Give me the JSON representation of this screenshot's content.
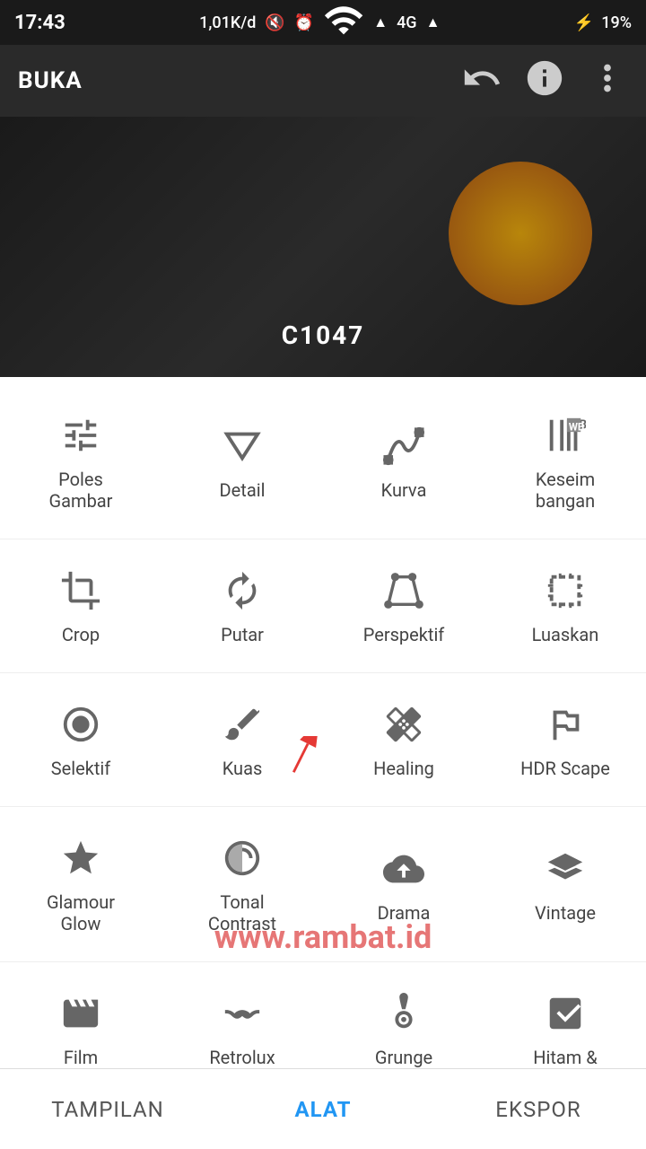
{
  "statusBar": {
    "time": "17:43",
    "network": "1,01K/d",
    "carrier": "4G",
    "battery": "19%"
  },
  "topBar": {
    "title": "BUKA"
  },
  "preview": {
    "label": "C1047"
  },
  "toolsGrid": {
    "rows": [
      [
        {
          "id": "poles-gambar",
          "label": "Poles\nGambar",
          "icon": "sliders"
        },
        {
          "id": "detail",
          "label": "Detail",
          "icon": "triangle-down"
        },
        {
          "id": "kurva",
          "label": "Kurva",
          "icon": "curve"
        },
        {
          "id": "keseimbangan",
          "label": "Keseim\nbangan",
          "icon": "wb"
        }
      ],
      [
        {
          "id": "crop",
          "label": "Crop",
          "icon": "crop"
        },
        {
          "id": "putar",
          "label": "Putar",
          "icon": "rotate"
        },
        {
          "id": "perspektif",
          "label": "Perspektif",
          "icon": "perspective"
        },
        {
          "id": "luaskan",
          "label": "Luaskan",
          "icon": "expand-crop"
        }
      ],
      [
        {
          "id": "selektif",
          "label": "Selektif",
          "icon": "circle-dot"
        },
        {
          "id": "kuas",
          "label": "Kuas",
          "icon": "brush"
        },
        {
          "id": "healing",
          "label": "Healing",
          "icon": "bandage"
        },
        {
          "id": "hdr-scape",
          "label": "HDR Scape",
          "icon": "mountain"
        }
      ],
      [
        {
          "id": "glamour-glow",
          "label": "Glamour\nGlow",
          "icon": "glamour"
        },
        {
          "id": "tonal-contrast",
          "label": "Tonal\nContrast",
          "icon": "tonal"
        },
        {
          "id": "drama",
          "label": "Drama",
          "icon": "drama"
        },
        {
          "id": "vintage",
          "label": "Vintage",
          "icon": "vintage"
        }
      ],
      [
        {
          "id": "film",
          "label": "Film",
          "icon": "film"
        },
        {
          "id": "retrolux",
          "label": "Retrolux",
          "icon": "mustache"
        },
        {
          "id": "grunge",
          "label": "Grunge",
          "icon": "guitar"
        },
        {
          "id": "hitam",
          "label": "Hitam &",
          "icon": "hitam"
        }
      ]
    ]
  },
  "watermark": "www.rambat.id",
  "bottomNav": {
    "items": [
      {
        "id": "tampilan",
        "label": "TAMPILAN",
        "active": false
      },
      {
        "id": "alat",
        "label": "ALAT",
        "active": true
      },
      {
        "id": "ekspor",
        "label": "EKSPOR",
        "active": false
      }
    ]
  }
}
